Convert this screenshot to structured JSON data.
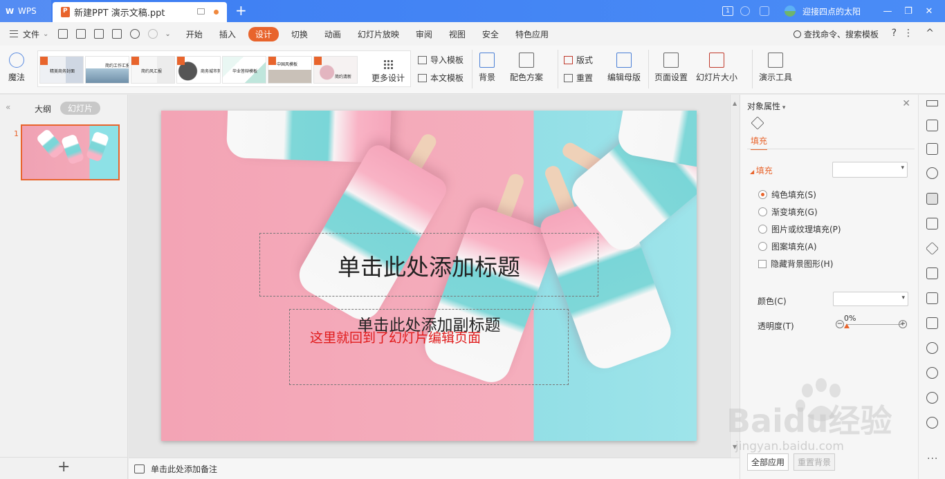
{
  "titlebar": {
    "app_name": "WPS",
    "doc_tab_title": "新建PPT 演示文稿.ppt",
    "new_tab": "+",
    "badge": "1",
    "user_name": "迎接四点的太阳",
    "win_min": "—",
    "win_max": "❐",
    "win_close": "✕"
  },
  "menubar": {
    "file_label": "文件",
    "tabs": [
      "开始",
      "插入",
      "设计",
      "切换",
      "动画",
      "幻灯片放映",
      "审阅",
      "视图",
      "安全",
      "特色应用"
    ],
    "active_tab": "设计",
    "search_label": "查找命令、搜索模板",
    "help": "?",
    "more": "⋮",
    "collapse": "^"
  },
  "ribbon": {
    "magic": "魔法",
    "templates": [
      "精美商务封面",
      "简约工作汇报",
      "简约风汇报",
      "商务城市剪影",
      "毕业答辩模板",
      "中国风模板",
      "简约清新"
    ],
    "more_design": "更多设计",
    "import_template": "导入模板",
    "this_template": "本文模板",
    "background": "背景",
    "color_scheme": "配色方案",
    "layout": "版式",
    "reset": "重置",
    "edit_master": "编辑母版",
    "page_setup": "页面设置",
    "slide_size": "幻灯片大小",
    "present_tools": "演示工具"
  },
  "left_panel": {
    "collapse": "«",
    "tab_outline": "大纲",
    "tab_slides": "幻灯片",
    "slide_number": "1",
    "add": "+"
  },
  "slide": {
    "title_placeholder": "单击此处添加标题",
    "subtitle_placeholder": "单击此处添加副标题",
    "annotation": "这里就回到了幻灯片编辑页面"
  },
  "notes": {
    "placeholder": "单击此处添加备注"
  },
  "properties": {
    "panel_title": "对象属性",
    "close": "✕",
    "tab_fill": "填充",
    "section_fill": "填充",
    "options": [
      "纯色填充(S)",
      "渐变填充(G)",
      "图片或纹理填充(P)",
      "图案填充(A)"
    ],
    "selected_option": "纯色填充(S)",
    "hide_bg": "隐藏背景图形(H)",
    "color_label": "颜色(C)",
    "transparency_label": "透明度(T)",
    "transparency_value": "0%",
    "minus": "−",
    "plus": "+",
    "apply_all": "全部应用",
    "reset_bg": "重置背景"
  },
  "rail": {
    "more": "···"
  },
  "watermark": {
    "brand": "Baidu经验",
    "url": "jingyan.baidu.com"
  },
  "colors": {
    "titlebar": "#3d7df2",
    "accent": "#e8642c",
    "annotation": "#e01a1a",
    "slide_pink": "#f3a4b5",
    "slide_cyan": "#93dfe6"
  }
}
